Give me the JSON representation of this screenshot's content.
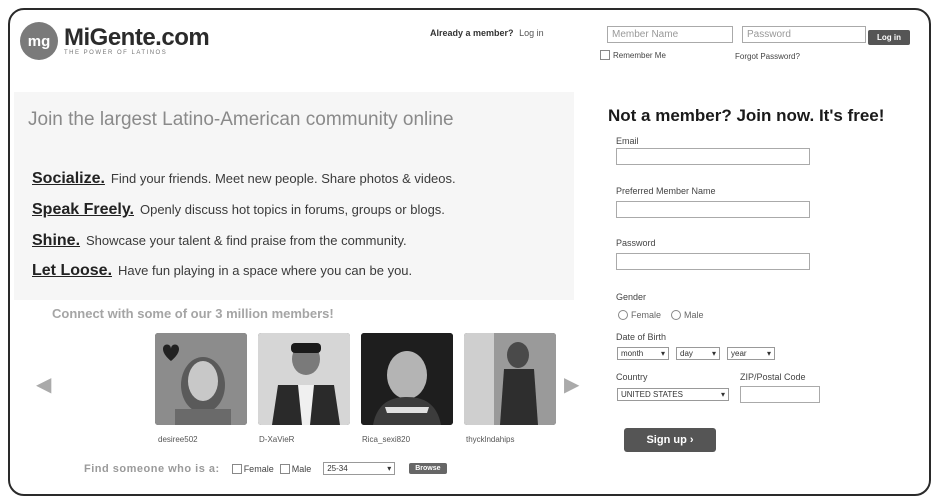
{
  "header": {
    "logo_letters": "mg",
    "logo_name": "MiGente.com",
    "logo_tagline": "THE POWER OF LATINOS",
    "already_member": "Already a member?",
    "login_link": "Log in",
    "member_name_placeholder": "Member Name",
    "password_placeholder": "Password",
    "login_button": "Log in",
    "remember_me": "Remember Me",
    "forgot_password": "Forgot Password?"
  },
  "hero": {
    "headline": "Join the largest Latino-American community online",
    "features": [
      {
        "title": "Socialize.",
        "text": "Find your friends. Meet new people. Share photos & videos."
      },
      {
        "title": "Speak Freely.",
        "text": "Openly discuss hot topics in forums, groups or blogs."
      },
      {
        "title": "Shine.",
        "text": "Showcase your talent & find praise from the community."
      },
      {
        "title": "Let Loose.",
        "text": "Have fun playing in a space where you can be you."
      }
    ]
  },
  "members": {
    "heading": "Connect with some of our 3 million members!",
    "left_arrow": "◀",
    "right_arrow": "▶",
    "list": [
      {
        "name": "desiree502"
      },
      {
        "name": "D-XaVieR"
      },
      {
        "name": "Rica_sexi820"
      },
      {
        "name": "thycklndahips"
      }
    ]
  },
  "find": {
    "label": "Find someone who is a:",
    "female": "Female",
    "male": "Male",
    "age_range": "25-34",
    "browse_button": "Browse"
  },
  "join": {
    "title": "Not a member? Join now. It's free!",
    "email_label": "Email",
    "member_name_label": "Preferred Member Name",
    "password_label": "Password",
    "gender_label": "Gender",
    "female": "Female",
    "male": "Male",
    "dob_label": "Date of Birth",
    "month": "month",
    "day": "day",
    "year": "year",
    "country_label": "Country",
    "country_value": "UNITED STATES",
    "zip_label": "ZIP/Postal Code",
    "signup_button": "Sign up ›"
  }
}
